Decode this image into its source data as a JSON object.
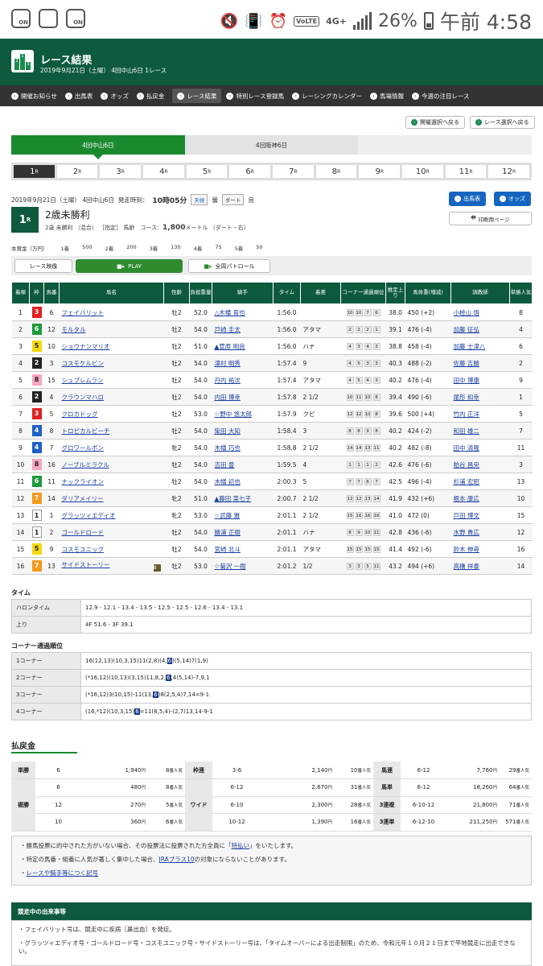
{
  "status": {
    "battery": "26%",
    "time": "午前 4:58",
    "network": "4G+",
    "volte": "VoLTE",
    "on1": "ON",
    "on2": "ON"
  },
  "header": {
    "title": "レース結果",
    "subtitle": "2019年9月21日（土曜） 4回中山6日 1レース",
    "logo_digits": [
      "2",
      "1",
      "3"
    ]
  },
  "nav": [
    "開催お知らせ",
    "出馬表",
    "オッズ",
    "払戻金",
    "レース結果",
    "特別レース登録馬",
    "レーシングカレンダー",
    "馬場情報",
    "今週の注目レース"
  ],
  "select_buttons": {
    "prev": "開催選択へ戻る",
    "race": "レース選択へ戻る"
  },
  "venue_tabs": [
    "4回中山6日",
    "4回阪神6日"
  ],
  "race_tabs": [
    "1",
    "2",
    "3",
    "4",
    "5",
    "6",
    "7",
    "8",
    "9",
    "10",
    "11",
    "12"
  ],
  "race_suffix": "R",
  "race_info": {
    "date": "2019年9月21日（土曜） 4回中山6日",
    "post_time_label": "発走時刻：",
    "post_time": "10時05分",
    "weather_label": "天候",
    "weather": "曇",
    "track_label": "ダート",
    "track": "良",
    "number": "1",
    "name": "2歳未勝利",
    "detail": "2歳 未勝利 （混合） ［指定］ 馬齢　コース：",
    "distance": "1,800",
    "distance_unit": "メートル （ダート・右）",
    "entry_btn": "出馬表",
    "odds_btn": "オッズ",
    "print_btn": "印刷用ページ"
  },
  "prize": [
    "本賞金（万円）",
    "1着",
    "500",
    "2着",
    "200",
    "3着",
    "130",
    "4着",
    "75",
    "5着",
    "50"
  ],
  "video": {
    "label": "レース映像",
    "play": "PLAY",
    "patrol": "全周パトロール"
  },
  "table_headers": [
    "着順",
    "枠",
    "馬番",
    "馬名",
    "性齢",
    "負担重量",
    "騎手",
    "タイム",
    "着差",
    "コーナー通過順位",
    "推定上り",
    "馬体重(増減)",
    "調教師",
    "単勝人気"
  ],
  "results": [
    {
      "pos": "1",
      "waku": "3",
      "num": "6",
      "horse": "フェイバリット",
      "sex": "牡2",
      "wt": "52.0",
      "jockey": "△木幡 育也",
      "time": "1:56.0",
      "margin": "",
      "c": [
        "10",
        "10",
        "7",
        "6"
      ],
      "agari": "38.0",
      "body": "450 (+2)",
      "trainer": "小桧山 悟",
      "pop": "8"
    },
    {
      "pos": "2",
      "waku": "6",
      "num": "12",
      "horse": "モルタル",
      "sex": "牡2",
      "wt": "54.0",
      "jockey": "戸崎 圭太",
      "time": "1:56.0",
      "margin": "アタマ",
      "c": [
        "2",
        "2",
        "2",
        "1"
      ],
      "agari": "39.1",
      "body": "476 (-4)",
      "trainer": "加藤 征弘",
      "pop": "4"
    },
    {
      "pos": "3",
      "waku": "5",
      "num": "10",
      "horse": "ショウナンマリオ",
      "sex": "牡2",
      "wt": "51.0",
      "jockey": "▲菅原 明良",
      "time": "1:56.0",
      "margin": "ハナ",
      "c": [
        "4",
        "3",
        "4",
        "3"
      ],
      "agari": "38.8",
      "body": "458 (-4)",
      "trainer": "加藤 士津八",
      "pop": "6"
    },
    {
      "pos": "4",
      "waku": "2",
      "num": "3",
      "horse": "コスモケルビン",
      "sex": "牡2",
      "wt": "54.0",
      "jockey": "津村 明秀",
      "time": "1:57.4",
      "margin": "9",
      "c": [
        "4",
        "5",
        "3",
        "3"
      ],
      "agari": "40.3",
      "body": "488 (-2)",
      "trainer": "佐藤 吉勝",
      "pop": "2"
    },
    {
      "pos": "5",
      "waku": "8",
      "num": "15",
      "horse": "シュプレムラン",
      "sex": "牡2",
      "wt": "54.0",
      "jockey": "丹内 祐次",
      "time": "1:57.4",
      "margin": "アタマ",
      "c": [
        "4",
        "5",
        "4",
        "3"
      ],
      "agari": "40.2",
      "body": "476 (-4)",
      "trainer": "田中 博康",
      "pop": "9"
    },
    {
      "pos": "6",
      "waku": "2",
      "num": "4",
      "horse": "クラウンマハロ",
      "sex": "牡2",
      "wt": "54.0",
      "jockey": "内田 博幸",
      "time": "1:57.8",
      "margin": "2 1/2",
      "c": [
        "10",
        "11",
        "10",
        "8"
      ],
      "agari": "39.4",
      "body": "490 (-6)",
      "trainer": "尾形 和幸",
      "pop": "1"
    },
    {
      "pos": "7",
      "waku": "3",
      "num": "5",
      "horse": "クロカドッグ",
      "sex": "牡2",
      "wt": "53.0",
      "jockey": "☆野中 悠太郎",
      "time": "1:57.9",
      "margin": "クビ",
      "c": [
        "12",
        "12",
        "10",
        "8"
      ],
      "agari": "39.6",
      "body": "500 (+4)",
      "trainer": "竹内 正洋",
      "pop": "5"
    },
    {
      "pos": "8",
      "waku": "4",
      "num": "8",
      "horse": "トロピカルビーチ",
      "sex": "牡2",
      "wt": "54.0",
      "jockey": "柴田 大知",
      "time": "1:58.4",
      "margin": "3",
      "c": [
        "8",
        "8",
        "9",
        "8"
      ],
      "agari": "40.2",
      "body": "424 (-2)",
      "trainer": "和田 雄二",
      "pop": "7"
    },
    {
      "pos": "9",
      "waku": "4",
      "num": "7",
      "horse": "グロワールボン",
      "sex": "牝2",
      "wt": "54.0",
      "jockey": "木幡 巧也",
      "time": "1:58.8",
      "margin": "2 1/2",
      "c": [
        "14",
        "14",
        "13",
        "11"
      ],
      "agari": "40.2",
      "body": "482 (-8)",
      "trainer": "田中 清隆",
      "pop": "11"
    },
    {
      "pos": "10",
      "waku": "8",
      "num": "16",
      "horse": "ノーブルミラクル",
      "sex": "牡2",
      "wt": "54.0",
      "jockey": "吉田 豊",
      "time": "1:59.5",
      "margin": "4",
      "c": [
        "1",
        "1",
        "1",
        "2"
      ],
      "agari": "42.6",
      "body": "476 (-6)",
      "trainer": "粕谷 昌央",
      "pop": "3"
    },
    {
      "pos": "11",
      "waku": "6",
      "num": "11",
      "horse": "ナックライオン",
      "sex": "牡2",
      "wt": "54.0",
      "jockey": "木幡 初也",
      "time": "2:00.3",
      "margin": "5",
      "c": [
        "7",
        "7",
        "6",
        "7"
      ],
      "agari": "42.5",
      "body": "496 (-4)",
      "trainer": "杉浦 宏昭",
      "pop": "13"
    },
    {
      "pos": "12",
      "waku": "7",
      "num": "14",
      "horse": "ダリアメイリー",
      "sex": "牝2",
      "wt": "51.0",
      "jockey": "▲藤田 菜七子",
      "time": "2:00.7",
      "margin": "2 1/2",
      "c": [
        "12",
        "12",
        "13",
        "14"
      ],
      "agari": "41.9",
      "body": "432 (+6)",
      "trainer": "根本 康広",
      "pop": "10"
    },
    {
      "pos": "13",
      "waku": "1",
      "num": "1",
      "horse": "グラッツィエディオ",
      "sex": "牝2",
      "wt": "53.0",
      "jockey": "☆武藤 雅",
      "time": "2:01.1",
      "margin": "2 1/2",
      "c": [
        "15",
        "16",
        "16",
        "16"
      ],
      "agari": "41.0",
      "body": "472 (0)",
      "trainer": "戸田 博文",
      "pop": "15"
    },
    {
      "pos": "14",
      "waku": "1",
      "num": "2",
      "horse": "ゴールドロード",
      "sex": "牡2",
      "wt": "54.0",
      "jockey": "勝浦 正樹",
      "time": "2:01.1",
      "margin": "ハナ",
      "c": [
        "8",
        "9",
        "10",
        "11"
      ],
      "agari": "42.8",
      "body": "436 (-6)",
      "trainer": "水野 貴広",
      "pop": "12"
    },
    {
      "pos": "15",
      "waku": "5",
      "num": "9",
      "horse": "コスモユニック",
      "sex": "牡2",
      "wt": "54.0",
      "jockey": "宮崎 北斗",
      "time": "2:01.1",
      "margin": "アタマ",
      "c": [
        "15",
        "15",
        "15",
        "15"
      ],
      "agari": "41.4",
      "body": "492 (-6)",
      "trainer": "鈴木 伸尋",
      "pop": "16"
    },
    {
      "pos": "16",
      "waku": "7",
      "num": "13",
      "horse": "サイドストーリー",
      "sex": "牡2",
      "wt": "53.0",
      "jockey": "☆菊沢 一樹",
      "time": "2:01.2",
      "margin": "1/2",
      "c": [
        "3",
        "3",
        "5",
        "11"
      ],
      "agari": "43.2",
      "body": "494 (+6)",
      "trainer": "高橋 祥泰",
      "pop": "14",
      "blinker": "B"
    }
  ],
  "waku_colors": {
    "1": "#ffffff",
    "2": "#222222",
    "3": "#e02020",
    "4": "#1e5fc8",
    "5": "#f5d90a",
    "6": "#1c9a3c",
    "7": "#f39a1e",
    "8": "#f7a6c4"
  },
  "timing": {
    "title": "タイム",
    "rows": [
      {
        "label": "ハロンタイム",
        "value": "12.9 - 12.1 - 13.4 - 13.5 - 12.5 - 12.5 - 12.6 - 13.4 - 13.1"
      },
      {
        "label": "上り",
        "value": "4F 51.6 - 3F 39.1"
      }
    ]
  },
  "corners": {
    "title": "コーナー通過順位",
    "rows": [
      {
        "label": "1コーナー",
        "pre": "16(12,13)(10,3,15)11(2,8)(4,",
        "hl": "6",
        "post": ")(5,14)7(1,9)"
      },
      {
        "label": "2コーナー",
        "pre": "(*16,12)(10,13)(3,15)11,8,2,",
        "hl": "6",
        "post": ",4(5,14)-7,9,1"
      },
      {
        "label": "3コーナー",
        "pre": "(*16,12)3(10,15)-11(13,",
        "hl": "6",
        "post": ")8(2,5,4)7,14=9-1"
      },
      {
        "label": "4コーナー",
        "pre": "(16,*12)(10,3,15)",
        "hl": "6",
        "post": "=11(8,5,4)-(2,7)13,14-9-1"
      }
    ]
  },
  "payout_title": "払戻金",
  "payout_units": {
    "yen": "円",
    "pop": "番人気"
  },
  "payouts": {
    "tansho": {
      "label": "単勝",
      "rows": [
        {
          "num": "6",
          "yen": "1,940",
          "pop": "8"
        }
      ]
    },
    "fukusho": {
      "label": "複勝",
      "rows": [
        {
          "num": "6",
          "yen": "480",
          "pop": "8"
        },
        {
          "num": "12",
          "yen": "270",
          "pop": "5"
        },
        {
          "num": "10",
          "yen": "360",
          "pop": "6"
        }
      ]
    },
    "wakuren": {
      "label": "枠連",
      "rows": [
        {
          "num": "3-6",
          "yen": "2,140",
          "pop": "10"
        }
      ]
    },
    "wide": {
      "label": "ワイド",
      "rows": [
        {
          "num": "6-12",
          "yen": "2,670",
          "pop": "31"
        },
        {
          "num": "6-10",
          "yen": "2,300",
          "pop": "28"
        },
        {
          "num": "10-12",
          "yen": "1,390",
          "pop": "16"
        }
      ]
    },
    "umaren": {
      "label": "馬連",
      "rows": [
        {
          "num": "6-12",
          "yen": "7,760",
          "pop": "29"
        }
      ]
    },
    "umatan": {
      "label": "馬単",
      "rows": [
        {
          "num": "6-12",
          "yen": "18,260",
          "pop": "64"
        }
      ]
    },
    "sanrenpuku": {
      "label": "3連複",
      "rows": [
        {
          "num": "6-10-12",
          "yen": "21,800",
          "pop": "71"
        }
      ]
    },
    "sanrentan": {
      "label": "3連単",
      "rows": [
        {
          "num": "6-12-10",
          "yen": "211,250",
          "pop": "571"
        }
      ]
    }
  },
  "notes": {
    "n1_pre": "勝馬投票に的中された方がいない場合、その投票法に投票された方全員に「",
    "n1_link": "特払い",
    "n1_post": "」をいたします。",
    "n2_pre": "特定の馬番・組番に人気が著しく集中した場合、",
    "n2_link": "JRAプラス10",
    "n2_post": "の対象にならないことがあります。",
    "n3_link": "レースや騎手等につく記号"
  },
  "incidents": {
    "title": "競走中の出来事等",
    "items": [
      "フェイバリット号は、競走中に疾病［鼻出血］を発症。",
      "グラッツィエディオ号・ゴールドロード号・コスモユニック号・サイドストーリー号は、「タイムオーバーによる出走制限」のため、令和元年１０月２１日まで平地競走に出走できない。"
    ]
  }
}
